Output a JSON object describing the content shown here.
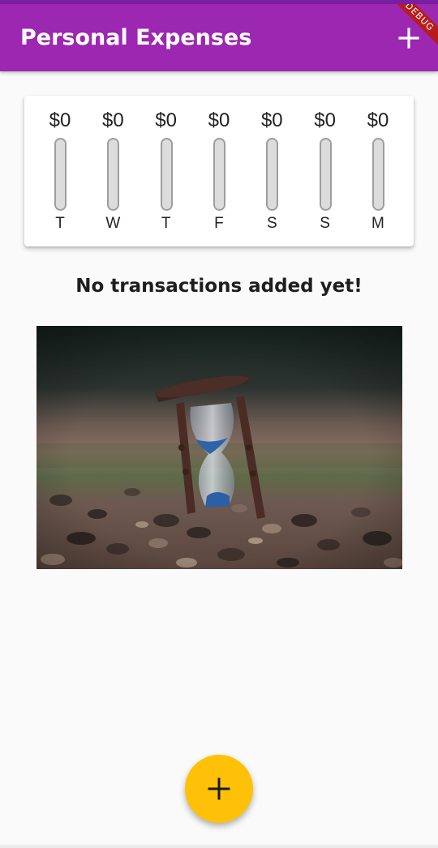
{
  "app_bar": {
    "title": "Personal Expenses",
    "add_icon": "plus-icon",
    "background_color": "#9c27b0",
    "debug_banner": "DEBUG"
  },
  "chart": {
    "bars": [
      {
        "amount": "$0",
        "day": "T",
        "fill_fraction": 0
      },
      {
        "amount": "$0",
        "day": "W",
        "fill_fraction": 0
      },
      {
        "amount": "$0",
        "day": "T",
        "fill_fraction": 0
      },
      {
        "amount": "$0",
        "day": "F",
        "fill_fraction": 0
      },
      {
        "amount": "$0",
        "day": "S",
        "fill_fraction": 0
      },
      {
        "amount": "$0",
        "day": "S",
        "fill_fraction": 0
      },
      {
        "amount": "$0",
        "day": "M",
        "fill_fraction": 0
      }
    ],
    "track_color": "#dcdcdc",
    "fill_color": "#9c27b0"
  },
  "empty_state": {
    "message": "No transactions added yet!",
    "image": "hourglass-on-gravel-photo"
  },
  "fab": {
    "icon": "plus-icon",
    "color": "#ffc107"
  }
}
